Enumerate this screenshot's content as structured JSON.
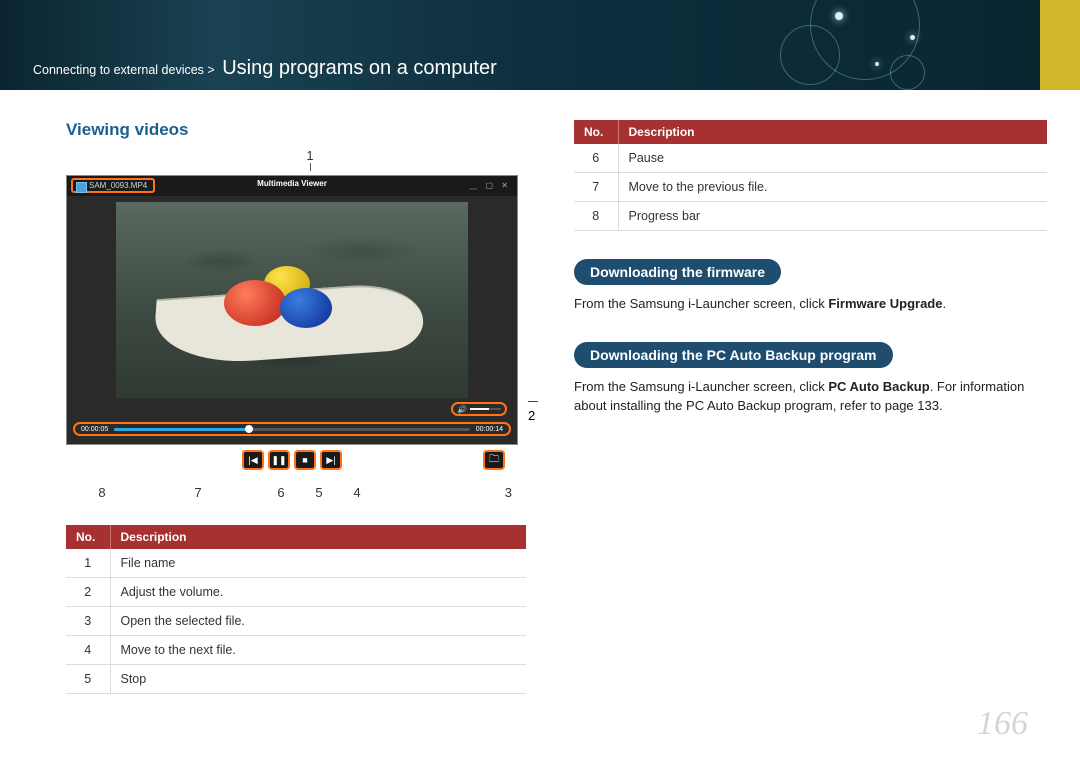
{
  "breadcrumb": {
    "prefix": "Connecting to external devices >",
    "main": "Using programs on a computer"
  },
  "left": {
    "section_title": "Viewing videos",
    "callout_top": "1",
    "player": {
      "filename": "SAM_0093.MP4",
      "title": "Multimedia Viewer",
      "time_current": "00:00:05",
      "time_total": "00:00:14"
    },
    "callout_right": "2",
    "callouts_bottom": [
      "8",
      "7",
      "6",
      "5",
      "4",
      "3"
    ],
    "table": {
      "headers": [
        "No.",
        "Description"
      ],
      "rows": [
        [
          "1",
          "File name"
        ],
        [
          "2",
          "Adjust the volume."
        ],
        [
          "3",
          "Open the selected file."
        ],
        [
          "4",
          "Move to the next file."
        ],
        [
          "5",
          "Stop"
        ]
      ]
    }
  },
  "right": {
    "table": {
      "headers": [
        "No.",
        "Description"
      ],
      "rows": [
        [
          "6",
          "Pause"
        ],
        [
          "7",
          "Move to the previous file."
        ],
        [
          "8",
          "Progress bar"
        ]
      ]
    },
    "pill1": "Downloading the firmware",
    "text1_a": "From the Samsung i-Launcher screen, click ",
    "text1_b": "Firmware Upgrade",
    "text1_c": ".",
    "pill2": "Downloading the PC Auto Backup program",
    "text2_a": "From the Samsung i-Launcher screen, click ",
    "text2_b": "PC Auto Backup",
    "text2_c": ". For information about installing the PC Auto Backup program, refer to page 133."
  },
  "page_number": "166"
}
